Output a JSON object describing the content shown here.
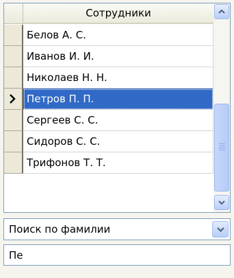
{
  "grid": {
    "column_header": "Сотрудники",
    "rows": [
      {
        "name": "Белов А. С.",
        "selected": false
      },
      {
        "name": "Иванов И. И.",
        "selected": false
      },
      {
        "name": "Николаев Н. Н.",
        "selected": false
      },
      {
        "name": "Петров П. П.",
        "selected": true
      },
      {
        "name": "Сергеев С. С.",
        "selected": false
      },
      {
        "name": "Сидоров С. С.",
        "selected": false
      },
      {
        "name": "Трифонов Т. Т.",
        "selected": false
      }
    ]
  },
  "search_mode": {
    "selected": "Поиск по фамилии"
  },
  "search_input": {
    "value": "Пе"
  },
  "colors": {
    "selection": "#3169c6",
    "border": "#7f9db9"
  }
}
